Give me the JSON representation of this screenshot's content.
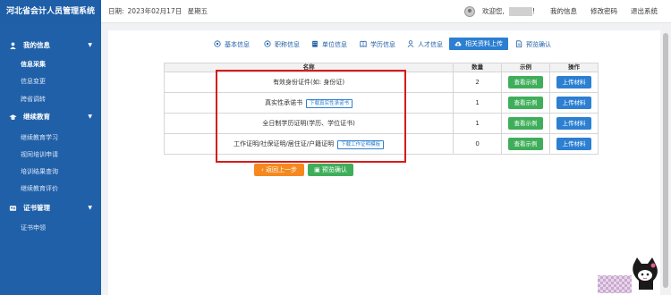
{
  "app": {
    "title": "河北省会计人员管理系统"
  },
  "header": {
    "date_label": "日期:",
    "date_value": "2023年02月17日",
    "weekday": "星期五",
    "welcome": "欢迎您,",
    "welcome_suffix": "!",
    "links": [
      "我的信息",
      "修改密码",
      "退出系统"
    ]
  },
  "sidebar": {
    "groups": [
      {
        "label": "我的信息",
        "icon": "user-icon",
        "items": [
          "信息采集",
          "信息变更",
          "跨省调转"
        ]
      },
      {
        "label": "继续教育",
        "icon": "graduation-cap-icon",
        "items": [
          "继续教育学习",
          "视同培训申请",
          "培训结果查询",
          "继续教育评价"
        ]
      },
      {
        "label": "证书管理",
        "icon": "id-card-icon",
        "items": [
          "证书申领"
        ]
      }
    ],
    "active_item": "信息采集"
  },
  "steps": [
    {
      "label": "基本信息",
      "icon": "target-icon"
    },
    {
      "label": "职称信息",
      "icon": "target-icon"
    },
    {
      "label": "单位信息",
      "icon": "building-icon"
    },
    {
      "label": "学历信息",
      "icon": "book-icon"
    },
    {
      "label": "人才信息",
      "icon": "person-icon"
    },
    {
      "label": "相关资料上传",
      "icon": "cloud-upload-icon",
      "active": true
    },
    {
      "label": "预览确认",
      "icon": "document-icon"
    }
  ],
  "table": {
    "headers": [
      "名称",
      "数量",
      "示例",
      "操作"
    ],
    "rows": [
      {
        "name": "有效身份证件(如: 身份证)",
        "template_link": "",
        "count": "2",
        "example": "查看示例",
        "action": "上传材料"
      },
      {
        "name": "真实性承诺书",
        "template_link": "下载真实性承诺书",
        "count": "1",
        "example": "查看示例",
        "action": "上传材料"
      },
      {
        "name": "全日制学历证明(学历、学位证书)",
        "template_link": "",
        "count": "1",
        "example": "查看示例",
        "action": "上传材料"
      },
      {
        "name": "工作证明/社保证明/居住证/户籍证明",
        "template_link": "下载工作证明模板",
        "count": "0",
        "example": "查看示例",
        "action": "上传材料"
      }
    ]
  },
  "buttons": {
    "back": "返回上一步",
    "confirm": "预览确认"
  },
  "colors": {
    "brand": "#1f5fa8",
    "sidebar": "#2060a9",
    "accent": "#2c7fd1",
    "green": "#3fae5a",
    "orange": "#f5891f",
    "highlight": "#d71a1a"
  }
}
